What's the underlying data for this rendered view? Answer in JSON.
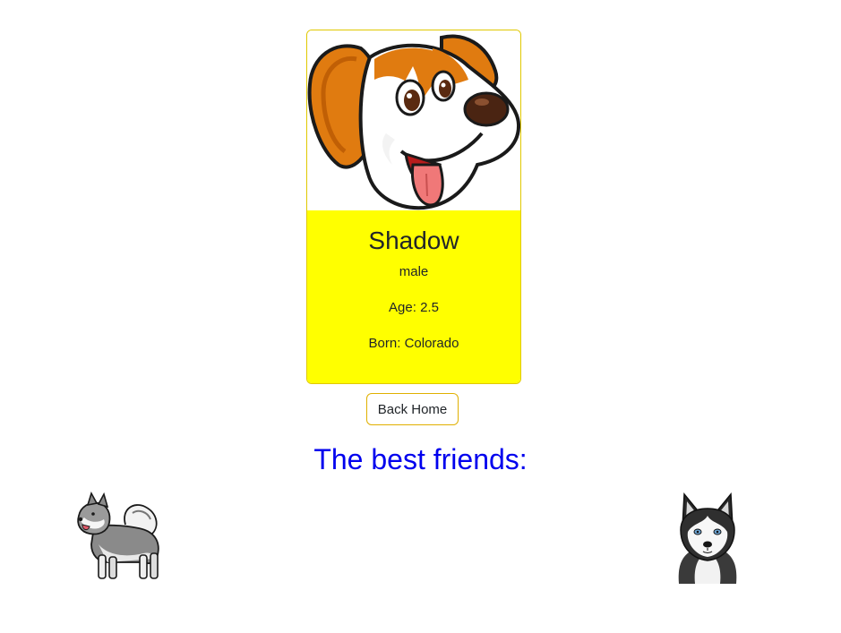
{
  "dog": {
    "name": "Shadow",
    "gender": "male",
    "age": "Age: 2.5",
    "born": "Born: Colorado"
  },
  "actions": {
    "back_label": "Back Home"
  },
  "friends": {
    "title": "The best friends:"
  },
  "colors": {
    "card_body": "#ffff00",
    "title_blue": "#0000ee",
    "border_gold": "#e0c800"
  }
}
